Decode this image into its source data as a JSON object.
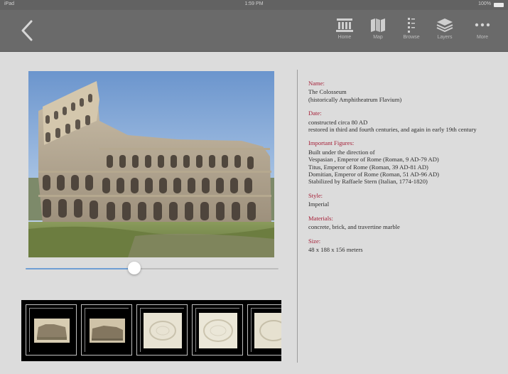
{
  "statusbar": {
    "carrier": "iPad",
    "time": "1:59 PM",
    "battery": "100%"
  },
  "nav": {
    "back_icon": "chevron-left-icon",
    "items": [
      {
        "label": "Home",
        "icon": "building-icon"
      },
      {
        "label": "Map",
        "icon": "map-icon"
      },
      {
        "label": "Browse",
        "icon": "list-icon"
      },
      {
        "label": "Layers",
        "icon": "layers-icon"
      },
      {
        "label": "More",
        "icon": "ellipsis-icon"
      }
    ]
  },
  "slider": {
    "value": 0.43
  },
  "info": {
    "name_label": "Name:",
    "name_lines": [
      "The Colosseum",
      "(historically Amphitheatrum Flavium)"
    ],
    "date_label": "Date:",
    "date_lines": [
      "constructed circa 80 AD",
      "restored in third and fourth centuries, and again in early 19th century"
    ],
    "figures_label": "Important Figures:",
    "figures_lines": [
      "Built under the direction of",
      "Vespasian , Emperor of Rome (Roman, 9 AD-79 AD)",
      "Titus, Emperor of Rome (Roman, 39 AD-81 AD)",
      "Domitian, Emperor of Rome (Roman, 51 AD-96 AD)",
      "Stabilized by Raffaele Stern (Italian, 1774-1820)"
    ],
    "style_label": "Style:",
    "style_lines": [
      "Imperial"
    ],
    "materials_label": "Materials:",
    "materials_lines": [
      "concrete, brick, and travertine marble"
    ],
    "size_label": "Size:",
    "size_lines": [
      "48 x 188 x 156 meters"
    ]
  },
  "colors": {
    "navbar": "#6a6a6a",
    "label_red": "#a51e36",
    "slider_blue": "#6f9fd4",
    "background": "#dcdcdc"
  }
}
